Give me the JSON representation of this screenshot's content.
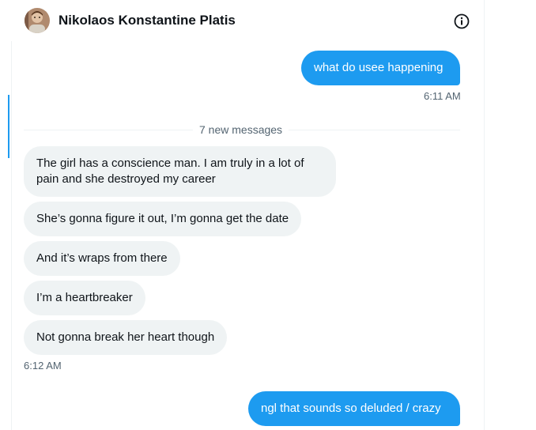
{
  "header": {
    "contact_name": "Nikolaos Konstantine Platis",
    "avatar_icon": "avatar-photo",
    "info_icon": "info-circle-icon"
  },
  "messages": {
    "sent_1": {
      "text": "what do usee happening",
      "time": "6:11 AM"
    },
    "divider_label": "7 new messages",
    "received": [
      "The girl has a conscience man. I am truly in a lot of pain and she destroyed my career",
      "She’s gonna figure it out, I’m gonna get the date",
      "And it’s wraps from there",
      "I’m a heartbreaker",
      "Not gonna break her heart though"
    ],
    "received_time": "6:12 AM",
    "sent_2": {
      "text": "ngl that sounds so deluded / crazy"
    }
  },
  "colors": {
    "accent": "#1d9bf0",
    "received_bubble": "#eff3f4",
    "secondary_text": "#536471"
  }
}
